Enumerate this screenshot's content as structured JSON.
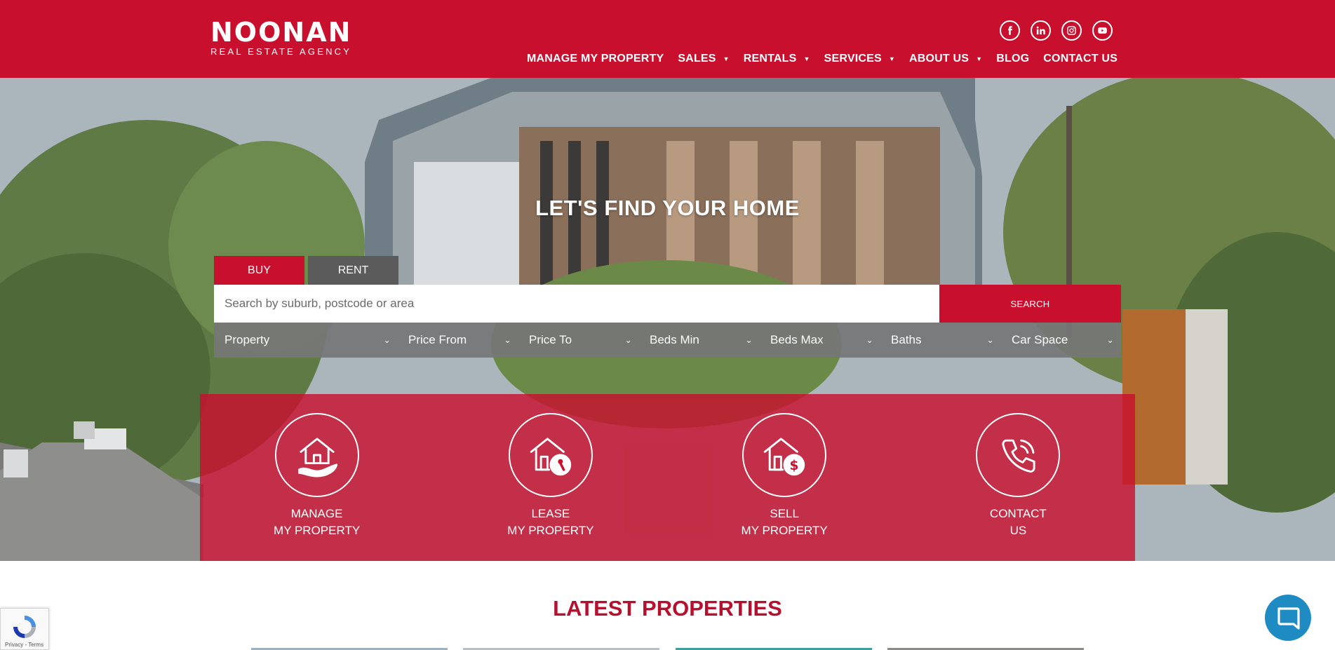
{
  "colors": {
    "brand_red": "#c8102e",
    "dark_tab": "#5b5b5b",
    "filter_bg": "#767676",
    "chat_blue": "#1e8bc3"
  },
  "header": {
    "logo_main": "NOONAN",
    "logo_sub": "REAL ESTATE AGENCY",
    "social": [
      "facebook-icon",
      "linkedin-icon",
      "instagram-icon",
      "youtube-icon"
    ],
    "nav": [
      {
        "label": "MANAGE MY PROPERTY",
        "dropdown": false
      },
      {
        "label": "SALES",
        "dropdown": true
      },
      {
        "label": "RENTALS",
        "dropdown": true
      },
      {
        "label": "SERVICES",
        "dropdown": true
      },
      {
        "label": "ABOUT US",
        "dropdown": true
      },
      {
        "label": "BLOG",
        "dropdown": false
      },
      {
        "label": "CONTACT US",
        "dropdown": false
      }
    ]
  },
  "hero": {
    "title": "LET'S FIND YOUR HOME",
    "tabs": {
      "buy": "BUY",
      "rent": "RENT"
    },
    "search": {
      "placeholder": "Search by suburb, postcode or area",
      "button": "SEARCH"
    },
    "filters": [
      "Property",
      "Price From",
      "Price To",
      "Beds Min",
      "Beds Max",
      "Baths",
      "Car Space"
    ]
  },
  "services": [
    {
      "line1": "MANAGE",
      "line2": "MY PROPERTY",
      "icon": "house-hand-icon"
    },
    {
      "line1": "LEASE",
      "line2": "MY PROPERTY",
      "icon": "house-key-icon"
    },
    {
      "line1": "SELL",
      "line2": "MY PROPERTY",
      "icon": "house-dollar-icon"
    },
    {
      "line1": "CONTACT",
      "line2": "US",
      "icon": "phone-icon"
    }
  ],
  "latest": {
    "title": "LATEST PROPERTIES"
  },
  "recaptcha": {
    "text": "Privacy - Terms"
  }
}
